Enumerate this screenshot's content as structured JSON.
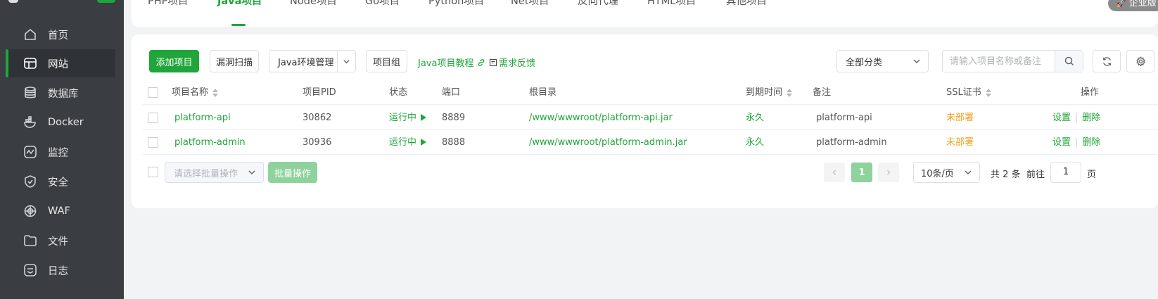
{
  "sidebar": {
    "items": [
      {
        "label": "首页",
        "icon": "home-icon"
      },
      {
        "label": "网站",
        "icon": "website-icon",
        "active": true
      },
      {
        "label": "数据库",
        "icon": "database-icon"
      },
      {
        "label": "Docker",
        "icon": "docker-icon"
      },
      {
        "label": "监控",
        "icon": "monitor-icon"
      },
      {
        "label": "安全",
        "icon": "shield-icon"
      },
      {
        "label": "WAF",
        "icon": "waf-icon"
      },
      {
        "label": "文件",
        "icon": "folder-icon"
      },
      {
        "label": "日志",
        "icon": "log-icon"
      }
    ]
  },
  "tabs": [
    {
      "label": "PHP项目"
    },
    {
      "label": "Java项目",
      "active": true
    },
    {
      "label": "Node项目"
    },
    {
      "label": "Go项目"
    },
    {
      "label": "Python项目"
    },
    {
      "label": "Net项目"
    },
    {
      "label": "反向代理"
    },
    {
      "label": "HTML项目"
    },
    {
      "label": "其他项目"
    }
  ],
  "edition_badge": "企业版",
  "toolbar": {
    "add_project": "添加项目",
    "vuln_scan": "漏洞扫描",
    "java_env": "Java环境管理",
    "project_group": "项目组",
    "tutorial_link": "Java项目教程",
    "feedback_link": "需求反馈",
    "category_select": "全部分类",
    "search_placeholder": "请输入项目名称或备注"
  },
  "table": {
    "headers": {
      "name": "项目名称",
      "pid": "项目PID",
      "status": "状态",
      "port": "端口",
      "root": "根目录",
      "expire": "到期时间",
      "remark": "备注",
      "ssl": "SSL证书",
      "actions": "操作"
    },
    "rows": [
      {
        "name": "platform-api",
        "pid": "30862",
        "status": "运行中",
        "port": "8889",
        "root": "/www/wwwroot/platform-api.jar",
        "expire": "永久",
        "remark": "platform-api",
        "ssl": "未部署",
        "settings": "设置",
        "delete": "删除"
      },
      {
        "name": "platform-admin",
        "pid": "30936",
        "status": "运行中",
        "port": "8888",
        "root": "/www/wwwroot/platform-admin.jar",
        "expire": "永久",
        "remark": "platform-admin",
        "ssl": "未部署",
        "settings": "设置",
        "delete": "删除"
      }
    ]
  },
  "footer": {
    "batch_placeholder": "请选择批量操作",
    "batch_button": "批量操作",
    "current_page": "1",
    "page_size": "10条/页",
    "total_prefix": "共",
    "total_count": "2",
    "total_suffix": "条",
    "goto_label": "前往",
    "goto_value": "1",
    "page_unit": "页"
  },
  "colors": {
    "brand_green": "#20a53a",
    "sidebar_bg": "#3a3d42",
    "warning_orange": "#f0a020"
  }
}
